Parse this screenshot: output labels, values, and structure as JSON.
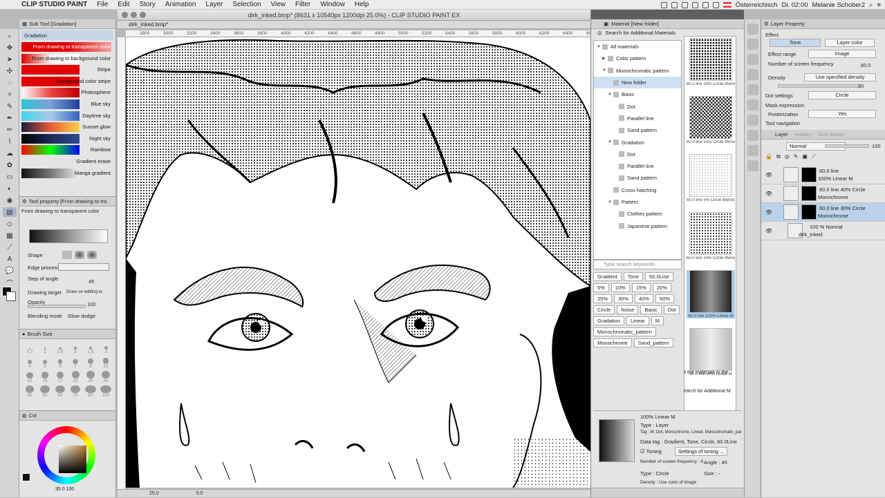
{
  "menubar": {
    "app": "CLIP STUDIO PAINT",
    "items": [
      "File",
      "Edit",
      "Story",
      "Animation",
      "Layer",
      "Selection",
      "View",
      "Filter",
      "Window",
      "Help"
    ],
    "region": "Österreichisch",
    "clock": "Di. 02:00",
    "user": "Melanie Schober2"
  },
  "subtool": {
    "header": "Sub Tool [Gradation]",
    "tab": "Gradation",
    "items": [
      {
        "label": "From drawing to transparent color",
        "colors": [
          "#e00000",
          "#e00000",
          "#f4a0a0"
        ]
      },
      {
        "label": "From drawing to background color",
        "colors": [
          "#e00000",
          "#f0f0f0",
          "#ffffff"
        ]
      },
      {
        "label": "Stripe",
        "colors": [
          "#e00000",
          "#e00000",
          "#e00000"
        ]
      },
      {
        "label": "Background color stripe",
        "colors": [
          "#e00000",
          "#e00000",
          "#e00000"
        ]
      },
      {
        "label": "Photosphere",
        "colors": [
          "#ffffff",
          "#e44",
          "#c00000"
        ]
      },
      {
        "label": "Blue sky",
        "colors": [
          "#2ec4d6",
          "#7aa2d8",
          "#1d3e99"
        ]
      },
      {
        "label": "Daytime sky",
        "colors": [
          "#3fd4e6",
          "#a7c9ea",
          "#3a61c0"
        ]
      },
      {
        "label": "Sunset glow",
        "colors": [
          "#1a1a3a",
          "#e85a3a",
          "#f7d34a"
        ]
      },
      {
        "label": "Night sky",
        "colors": [
          "#000000",
          "#1b2b55",
          "#2f4b8f"
        ]
      },
      {
        "label": "Rainbow",
        "colors": [
          "#ff0000",
          "#00ff00",
          "#0000ff"
        ]
      },
      {
        "label": "Gradient erase",
        "colors": [
          "#e4e4e4",
          "#e4e4e4",
          "#e4e4e4"
        ]
      },
      {
        "label": "Manga gradient",
        "colors": [
          "#111111",
          "#777777",
          "#eeeeee"
        ]
      }
    ]
  },
  "toolprop": {
    "header": "Tool property [From drawing to tra",
    "current": "From drawing to transparent color",
    "shape_label": "Shape",
    "edge_label": "Edge process",
    "step_label": "Step of angle",
    "step_value": "45",
    "target_label": "Drawing target",
    "target_value": "Draw on editing la",
    "opacity_label": "Opacity",
    "opacity_value": "100",
    "blend_label": "Blending mode",
    "blend_value": "Glow dodge"
  },
  "brush": {
    "header": "Brush Size",
    "sizes": [
      "0.7",
      "1",
      "1.5",
      "2",
      "2.5",
      "3",
      "4",
      "5",
      "6",
      "7",
      "8",
      "10",
      "12",
      "15",
      "17",
      "20",
      "25",
      "30",
      "40",
      "50",
      "60",
      "70",
      "80",
      "100"
    ]
  },
  "color": {
    "header": "Col",
    "status": "35  0  100"
  },
  "canvas": {
    "title": "dirk_inked.bmp* (8631 x 10540px 1200dpi 25.0%) - CLIP STUDIO PAINT EX",
    "tab": "dirk_inked.bmp*",
    "ruler": [
      "2800",
      "3000",
      "3200",
      "3400",
      "3600",
      "3800",
      "4000",
      "4200",
      "4400",
      "4600",
      "4800",
      "5000",
      "5200",
      "5400",
      "5600",
      "5800",
      "6000",
      "6200",
      "6400",
      "6600"
    ],
    "zoom": "25.0",
    "angle": "0.0"
  },
  "material": {
    "header": "Material [New folder]",
    "search_additional": "Search for Additional Materials",
    "tree": [
      {
        "label": "All materials",
        "depth": 0,
        "tw": "▼",
        "sel": false
      },
      {
        "label": "Color pattern",
        "depth": 1,
        "tw": "▶",
        "sel": false
      },
      {
        "label": "Monochromatic pattern",
        "depth": 1,
        "tw": "▼",
        "sel": false
      },
      {
        "label": "New folder",
        "depth": 2,
        "tw": "",
        "sel": true
      },
      {
        "label": "Basic",
        "depth": 2,
        "tw": "▼",
        "sel": false
      },
      {
        "label": "Dot",
        "depth": 3,
        "tw": "",
        "sel": false
      },
      {
        "label": "Parallel line",
        "depth": 3,
        "tw": "",
        "sel": false
      },
      {
        "label": "Sand pattern",
        "depth": 3,
        "tw": "",
        "sel": false
      },
      {
        "label": "Gradation",
        "depth": 2,
        "tw": "▼",
        "sel": false
      },
      {
        "label": "Dot",
        "depth": 3,
        "tw": "",
        "sel": false
      },
      {
        "label": "Parallel line",
        "depth": 3,
        "tw": "",
        "sel": false
      },
      {
        "label": "Sand pattern",
        "depth": 3,
        "tw": "",
        "sel": false
      },
      {
        "label": "Cross-hatching",
        "depth": 2,
        "tw": "",
        "sel": false
      },
      {
        "label": "Pattern",
        "depth": 2,
        "tw": "▼",
        "sel": false
      },
      {
        "label": "Clothes pattern",
        "depth": 3,
        "tw": "",
        "sel": false
      },
      {
        "label": "Japanese pattern",
        "depth": 3,
        "tw": "",
        "sel": false
      }
    ],
    "thumbs": [
      {
        "caption": "60.0 line 30% Circle Mono",
        "style": "dots-lg",
        "sel": false
      },
      {
        "caption": "60.0 line 50% Circle Mono",
        "style": "checker",
        "sel": false
      },
      {
        "caption": "60.0 line 5% Circle Monoc",
        "style": "dots-sm",
        "sel": false
      },
      {
        "caption": "60.0 line 25% Circle Mono",
        "style": "dots-md",
        "sel": false
      },
      {
        "caption": "60.0 line 100% Linear M",
        "style": "linear-dark",
        "sel": true
      },
      {
        "caption": "60.0 line 50% Linear M",
        "style": "linear-light",
        "sel": false
      }
    ],
    "side_text": [
      "ll the materials in the",
      "earch for Additional M"
    ],
    "keyword_placeholder": "Type search keywords",
    "tags": [
      "Gradient",
      "Tone",
      "60.0Line",
      "5%",
      "10%",
      "15%",
      "20%",
      "25%",
      "30%",
      "40%",
      "50%",
      "Circle",
      "Noise",
      "Basic",
      "Dot",
      "Gradation",
      "Linear",
      "M",
      "Monochromatic_pattern",
      "Monochrome",
      "Sand_pattern"
    ],
    "info": {
      "name": "100% Linear M",
      "type": "Type : Layer",
      "tag": "Tag : M, Dot, Monochrome, Linear, Monochromatic_pat",
      "datatag": "Data tag : Gradient, Tone, Circle, 60.0Line",
      "toning": "Toning",
      "toning_btn": "Settings of toning ...",
      "freq": "Number of screen frequency : 6",
      "angle": "Angle : 45",
      "shape": "Type : Circle",
      "size": "Size : -",
      "density": "Density : Use color of image"
    }
  },
  "layerprop": {
    "header": "Layer Property",
    "effect": "Effect",
    "tone": "Tone",
    "layer_color": "Layer color",
    "range_label": "Effect range",
    "range_value": "Image",
    "freq_label": "Number of screen frequency",
    "freq_value": "60.0",
    "density_label": "Density",
    "density_value": "Use specified density",
    "density_num": "30",
    "dot_label": "Dot settings",
    "dot_value": "Circle",
    "mask": "Mask expression",
    "poster_label": "Posterization",
    "poster_value": "Yes",
    "nav": "Tool navigation"
  },
  "layers": {
    "tabs": [
      "Layer",
      "History",
      "Auto Action"
    ],
    "blend": "Normal",
    "opacity": "100",
    "rows": [
      {
        "name": "60.0 line",
        "sub": "100% Linear M",
        "sel": false
      },
      {
        "name": "60.0 line 40% Circle",
        "sub": "Monochrome",
        "sel": false
      },
      {
        "name": "60.0 line 30% Circle",
        "sub": "Monochrome",
        "sel": true
      },
      {
        "name": "100 % Normal",
        "sub": "dirk_inked",
        "sel": false
      }
    ]
  }
}
